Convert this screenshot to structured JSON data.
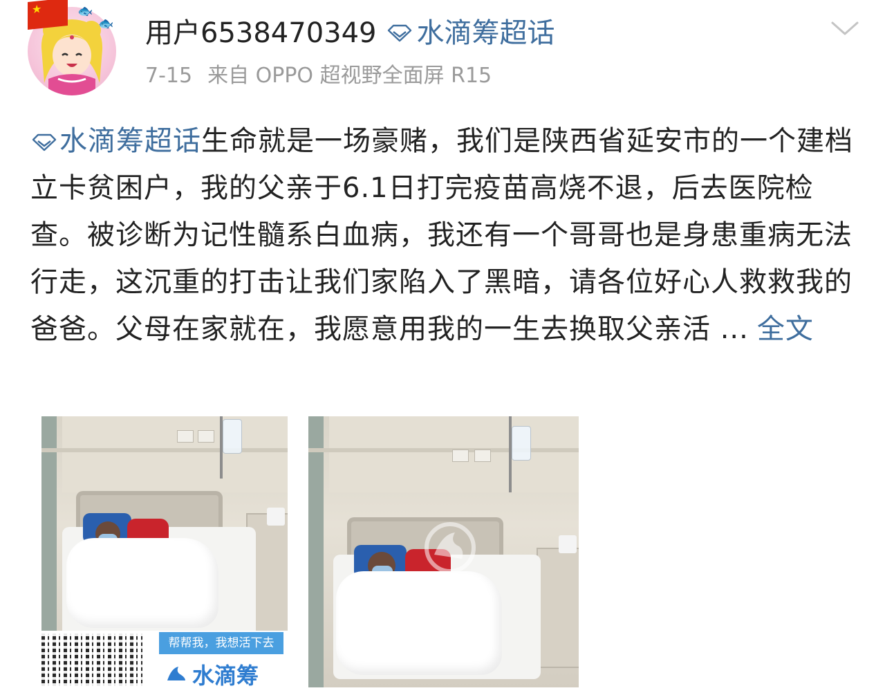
{
  "post": {
    "username": "用户6538470349",
    "header_topic": "水滴筹超话",
    "date": "7-15",
    "source": "来自 OPPO 超视野全面屏 R15",
    "content_topic": "水滴筹超话",
    "content_text": "生命就是一场豪赌，我们是陕西省延安市的一个建档立卡贫困户，我的父亲于6.1日打完疫苗高烧不退，后去医院检查。被诊断为记性髓系白血病，我还有一个哥哥也是身患重病无法行走，这沉重的打击让我们家陷入了黑暗，请各位好心人救救我的爸爸。父母在家就在，我愿意用我的一生去换取父亲活 ...",
    "more_label": "全文"
  },
  "photos": {
    "banner_text": "帮帮我，我想活下去",
    "brand_text": "水滴筹",
    "watermark_text": "水滴筹"
  },
  "colors": {
    "link": "#3f6e9e",
    "meta": "#9a9a9a",
    "text": "#222222",
    "banner": "#4a9fe0"
  },
  "icons": {
    "topic": "diamond-icon",
    "menu": "chevron-down-icon",
    "brand": "water-drop-logo"
  }
}
